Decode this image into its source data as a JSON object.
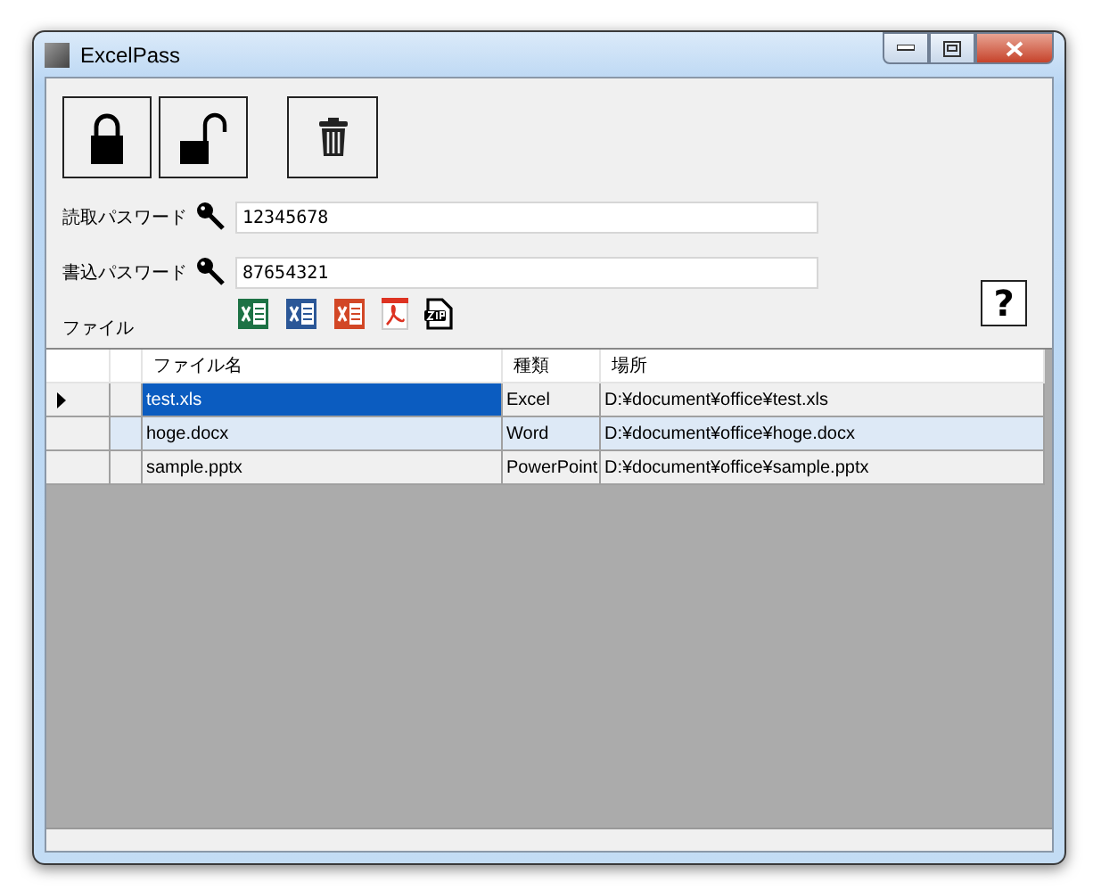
{
  "window": {
    "title": "ExcelPass"
  },
  "toolbar": [
    {
      "kind": "lock"
    },
    {
      "kind": "unlock"
    },
    {
      "kind": "delete"
    }
  ],
  "passwords": [
    {
      "label": "読取パスワード",
      "value": "12345678"
    },
    {
      "label": "書込パスワード",
      "value": "87654321"
    }
  ],
  "file_label": "ファイル",
  "file_types": [
    {
      "kind": "excel"
    },
    {
      "kind": "word"
    },
    {
      "kind": "powerpoint"
    },
    {
      "kind": "pdf"
    },
    {
      "kind": "zip"
    }
  ],
  "help_button": "?",
  "table": {
    "columns": [
      "ファイル名",
      "種類",
      "場所"
    ],
    "rows": [
      {
        "selected": true,
        "cells": [
          "test.xls",
          "Excel",
          "D:¥document¥office¥test.xls"
        ]
      },
      {
        "selected": false,
        "cells": [
          "hoge.docx",
          "Word",
          "D:¥document¥office¥hoge.docx"
        ]
      },
      {
        "selected": false,
        "cells": [
          "sample.pptx",
          "PowerPoint",
          "D:¥document¥office¥sample.pptx"
        ]
      }
    ]
  }
}
